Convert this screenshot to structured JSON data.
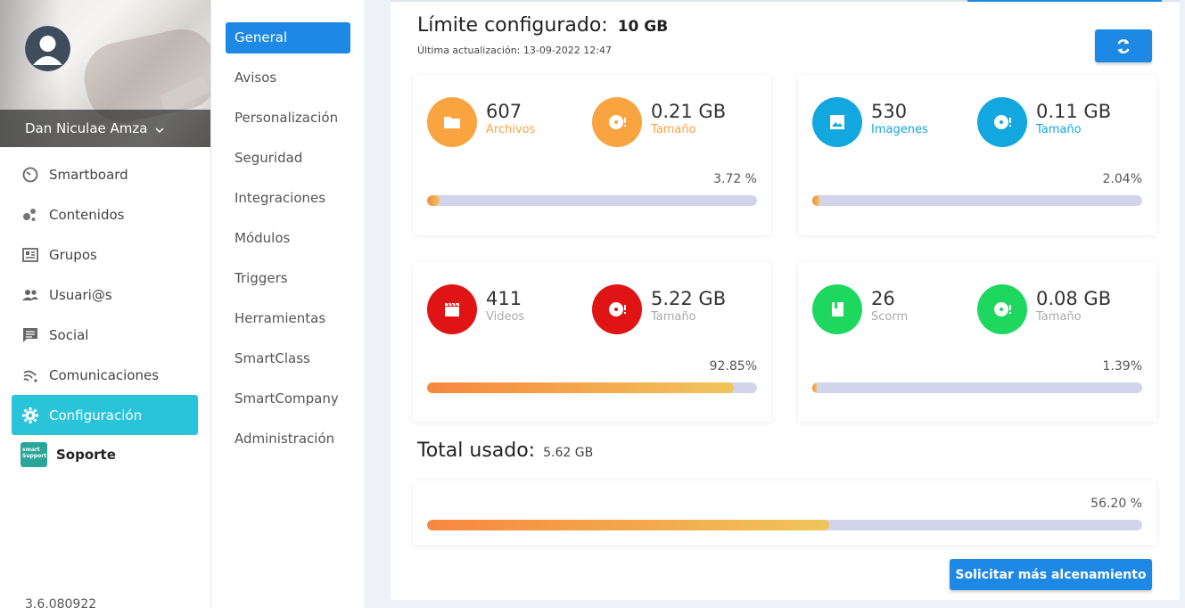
{
  "user": {
    "name": "Dan Niculae Amza"
  },
  "menu": [
    {
      "label": "Smartboard",
      "icon": "gauge-icon"
    },
    {
      "label": "Contenidos",
      "icon": "bubbles-icon"
    },
    {
      "label": "Grupos",
      "icon": "newspaper-icon"
    },
    {
      "label": "Usuari@s",
      "icon": "people-icon"
    },
    {
      "label": "Social",
      "icon": "chat-icon"
    },
    {
      "label": "Comunicaciones",
      "icon": "signal-icon"
    },
    {
      "label": "Configuración",
      "icon": "gear-icon",
      "active": true
    },
    {
      "label": "Soporte",
      "icon": "smart-support-logo",
      "logo_text": "smart Support"
    }
  ],
  "version": "3.6.080922",
  "subnav": [
    "General",
    "Avisos",
    "Personalización",
    "Seguridad",
    "Integraciones",
    "Módulos",
    "Triggers",
    "Herramientas",
    "SmartClass",
    "SmartCompany",
    "Administración"
  ],
  "limit": {
    "label": "Límite configurado:",
    "value": "10 GB",
    "last_update": "Última actualización: 13-09-2022 12:47"
  },
  "cards": [
    {
      "count": "607",
      "count_label": "Archivos",
      "size": "0.21 GB",
      "size_label": "Tamaño",
      "pct": "3.72 %",
      "fill": 3.72,
      "color": "#f9a441",
      "icon": "folder-icon"
    },
    {
      "count": "530",
      "count_label": "Imagenes",
      "size": "0.11 GB",
      "size_label": "Tamaño",
      "pct": "2.04%",
      "fill": 2.04,
      "color": "#12a8df",
      "icon": "image-icon"
    },
    {
      "count": "411",
      "count_label": "Videos",
      "size": "5.22 GB",
      "size_label": "Tamaño",
      "pct": "92.85%",
      "fill": 92.85,
      "color": "#e01414",
      "icon": "clapperboard-icon"
    },
    {
      "count": "26",
      "count_label": "Scorm",
      "size": "0.08 GB",
      "size_label": "Tamaño",
      "pct": "1.39%",
      "fill": 1.39,
      "color": "#1ed75f",
      "icon": "book-icon"
    }
  ],
  "total": {
    "label": "Total usado:",
    "value": "5.62 GB",
    "pct": "56.20 %",
    "fill": 56.2
  },
  "request_button": "Solicitar más alcenamiento",
  "colors": {
    "accent": "#1e88e5",
    "active_menu": "#29c4d9",
    "bar_track": "#d2d4eb"
  }
}
